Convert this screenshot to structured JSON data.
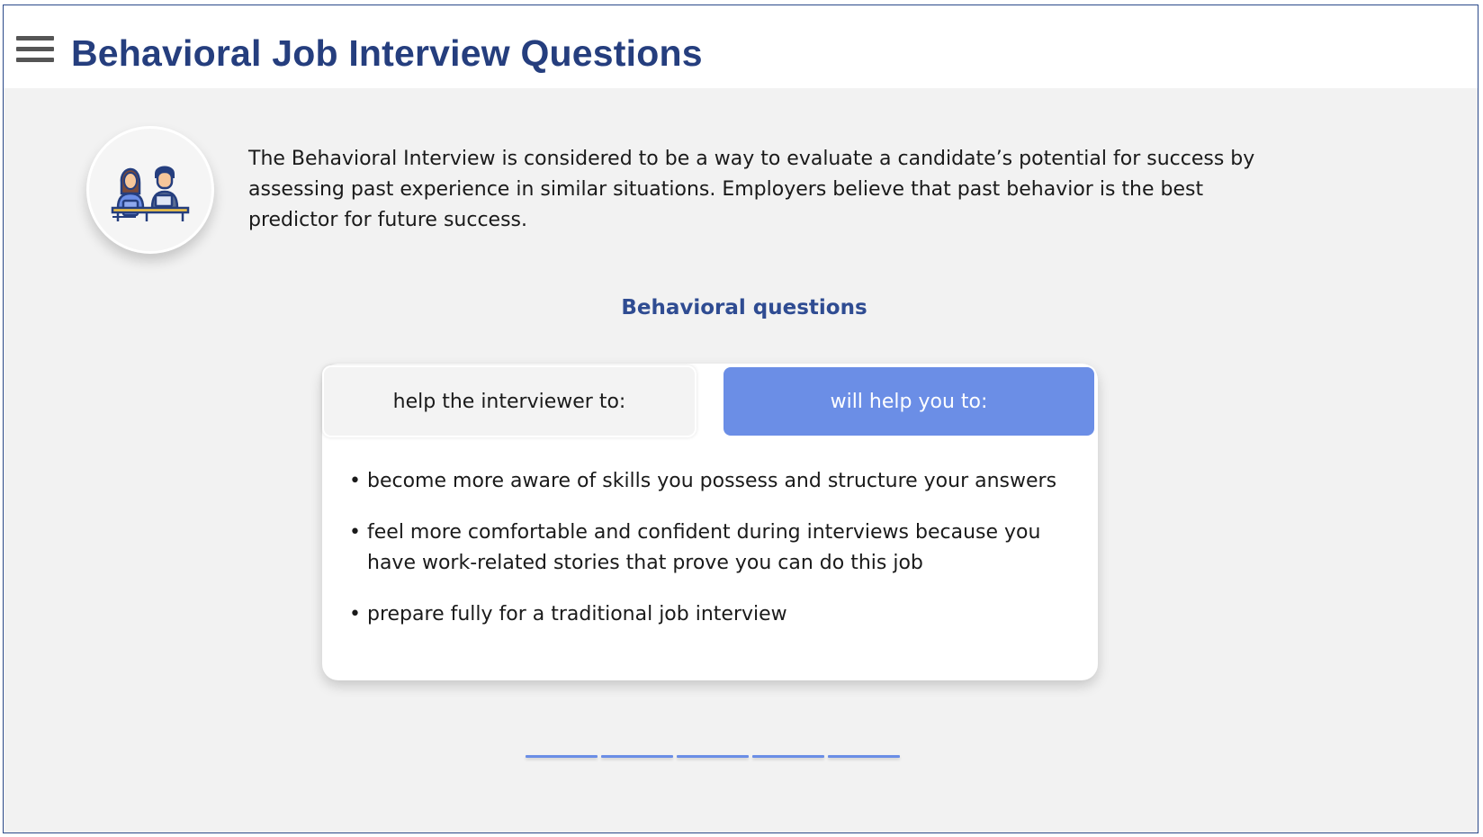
{
  "header": {
    "title": "Behavioral Job Interview Questions",
    "menu_icon": "hamburger-menu-icon"
  },
  "intro": {
    "avatar_icon": "interview-people-icon",
    "text": "The Behavioral Interview is considered to be a way to evaluate a candidate’s potential for success by assessing past experience in similar situations. Employers believe that past behavior is the best predictor for future success."
  },
  "section": {
    "heading": "Behavioral questions"
  },
  "tabs": [
    {
      "label": "help the interviewer to:",
      "active": false
    },
    {
      "label": "will help you to:",
      "active": true
    }
  ],
  "bullets": [
    "become more aware of skills you possess and structure your answers",
    "feel more comfortable and confident during interviews because you have work-related stories that prove you can do this job",
    "prepare fully for a traditional job interview"
  ],
  "pager": {
    "count": 5
  },
  "colors": {
    "title": "#253e7e",
    "accent": "#6b8ee6",
    "heading": "#2f4c92",
    "background": "#f2f2f2"
  }
}
